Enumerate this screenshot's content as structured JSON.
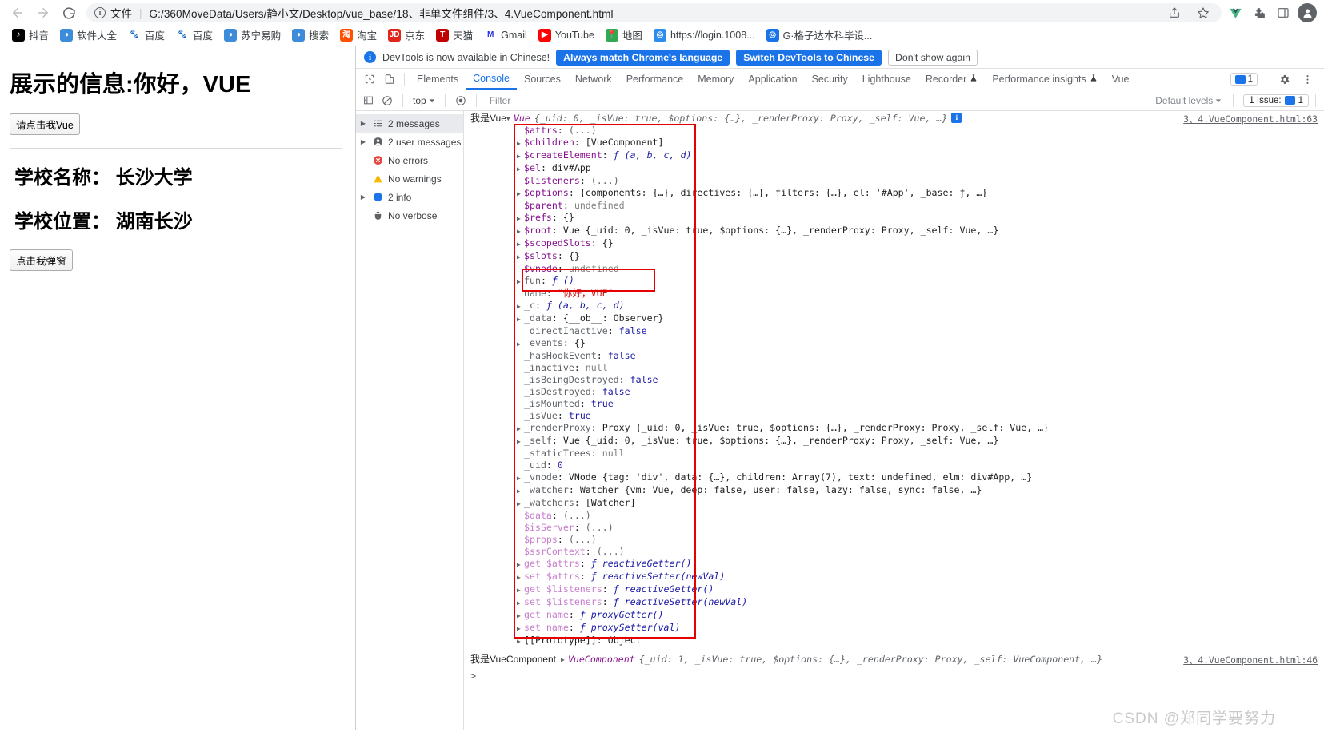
{
  "browser": {
    "nav": {
      "back": "←",
      "forward": "→",
      "reload": "↻"
    },
    "omnibox": {
      "scheme_label": "文件",
      "url": "G:/360MoveData/Users/静小文/Desktop/vue_base/18、非单文件组件/3、4.VueComponent.html",
      "info_icon": "info-icon",
      "share_icon": "share-icon",
      "star_icon": "bookmark-star-icon",
      "vue_ext_icon": "vue-extension-icon",
      "puzzle_icon": "extensions-puzzle-icon",
      "sidepanel_icon": "side-panel-icon",
      "profile_icon": "profile-avatar-icon"
    },
    "bookmarks": [
      {
        "label": "抖音",
        "icon": "douyin-icon",
        "color": "#000000",
        "glyph": "♪"
      },
      {
        "label": "软件大全",
        "icon": "globe-icon",
        "color": "#3c8cd9",
        "glyph": "◑"
      },
      {
        "label": "百度",
        "icon": "baidu-icon",
        "color": "#ffffff",
        "glyph": "🐾"
      },
      {
        "label": "百度",
        "icon": "baidu-icon",
        "color": "#ffffff",
        "glyph": "🐾"
      },
      {
        "label": "苏宁易购",
        "icon": "globe-icon",
        "color": "#3c8cd9",
        "glyph": "◑"
      },
      {
        "label": "搜索",
        "icon": "globe-icon",
        "color": "#3c8cd9",
        "glyph": "◑"
      },
      {
        "label": "淘宝",
        "icon": "taobao-icon",
        "color": "#ff5000",
        "glyph": "淘"
      },
      {
        "label": "京东",
        "icon": "jd-icon",
        "color": "#e1251b",
        "glyph": "JD"
      },
      {
        "label": "天猫",
        "icon": "tmall-icon",
        "color": "#c00000",
        "glyph": "T"
      },
      {
        "label": "Gmail",
        "icon": "gmail-icon",
        "color": "#ffffff",
        "glyph": "M"
      },
      {
        "label": "YouTube",
        "icon": "youtube-icon",
        "color": "#ff0000",
        "glyph": "▶"
      },
      {
        "label": "地图",
        "icon": "maps-icon",
        "color": "#34a853",
        "glyph": "📍"
      },
      {
        "label": "https://login.1008...",
        "icon": "globe-blue-icon",
        "color": "#2d8cf0",
        "glyph": "◎"
      },
      {
        "label": "G·格子达本科毕设...",
        "icon": "blue-swirl-icon",
        "color": "#1a73e8",
        "glyph": "◎"
      }
    ]
  },
  "page": {
    "heading": "展示的信息:你好，VUE",
    "button_vue": "请点击我Vue",
    "school_name": "学校名称： 长沙大学",
    "school_location": "学校位置： 湖南长沙",
    "button_alert": "点击我弹窗"
  },
  "devtools": {
    "banner": {
      "message": "DevTools is now available in Chinese!",
      "btn_always": "Always match Chrome's language",
      "btn_switch": "Switch DevTools to Chinese",
      "btn_dismiss": "Don't show again",
      "accent": "#1a73e8"
    },
    "tabs": [
      {
        "label": "Elements",
        "active": false,
        "warn": false
      },
      {
        "label": "Console",
        "active": true,
        "warn": false
      },
      {
        "label": "Sources",
        "active": false,
        "warn": false
      },
      {
        "label": "Network",
        "active": false,
        "warn": false
      },
      {
        "label": "Performance",
        "active": false,
        "warn": false
      },
      {
        "label": "Memory",
        "active": false,
        "warn": false
      },
      {
        "label": "Application",
        "active": false,
        "warn": false
      },
      {
        "label": "Security",
        "active": false,
        "warn": false
      },
      {
        "label": "Lighthouse",
        "active": false,
        "warn": false
      },
      {
        "label": "Recorder",
        "active": false,
        "warn": true
      },
      {
        "label": "Performance insights",
        "active": false,
        "warn": true
      },
      {
        "label": "Vue",
        "active": false,
        "warn": false
      }
    ],
    "tabs_right": {
      "issue_count": "1",
      "settings_icon": "gear-icon",
      "more_icon": "more-vertical-icon"
    },
    "filterbar": {
      "sidebar_toggle_icon": "sidebar-toggle-icon",
      "clear_icon": "clear-console-icon",
      "context": "top",
      "eye_icon": "live-expression-eye-icon",
      "filter_placeholder": "Filter",
      "filter_value": "",
      "levels": "Default levels",
      "issues_label": "1 Issue:",
      "issues_count": "1"
    },
    "sidebar": [
      {
        "label": "2 messages",
        "icon": "list-icon",
        "arrow": true,
        "selected": true
      },
      {
        "label": "2 user messages",
        "icon": "user-icon",
        "arrow": true,
        "selected": false
      },
      {
        "label": "No errors",
        "icon": "error-icon",
        "arrow": false,
        "selected": false
      },
      {
        "label": "No warnings",
        "icon": "warning-icon",
        "arrow": false,
        "selected": false
      },
      {
        "label": "2 info",
        "icon": "info-icon",
        "arrow": true,
        "selected": false
      },
      {
        "label": "No verbose",
        "icon": "bug-icon",
        "arrow": false,
        "selected": false
      }
    ],
    "console": {
      "msg1": {
        "prefix": "我是Vue",
        "summary_obj": "Vue",
        "summary_rest": "{_uid: 0, _isVue: true, $options: {…}, _renderProxy: Proxy, _self: Vue, …}",
        "source": "3、4.VueComponent.html:63",
        "info_badge": "i",
        "properties": [
          {
            "arrow": false,
            "key": "$attrs",
            "keycls": "t-key",
            "value": "(...)",
            "valcls": "t-dim"
          },
          {
            "arrow": true,
            "key": "$children",
            "keycls": "t-key",
            "value": "[VueComponent]",
            "valcls": "t-plain"
          },
          {
            "arrow": true,
            "key": "$createElement",
            "keycls": "t-key",
            "value": "ƒ (a, b, c, d)",
            "valcls": "t-fn"
          },
          {
            "arrow": true,
            "key": "$el",
            "keycls": "t-key",
            "value": "div#App",
            "valcls": "t-plain"
          },
          {
            "arrow": false,
            "key": "$listeners",
            "keycls": "t-key",
            "value": "(...)",
            "valcls": "t-dim"
          },
          {
            "arrow": true,
            "key": "$options",
            "keycls": "t-key",
            "value": "{components: {…}, directives: {…}, filters: {…}, el: '#App', _base: ƒ, …}",
            "valcls": "t-plain"
          },
          {
            "arrow": false,
            "key": "$parent",
            "keycls": "t-key",
            "value": "undefined",
            "valcls": "t-null"
          },
          {
            "arrow": true,
            "key": "$refs",
            "keycls": "t-key",
            "value": "{}",
            "valcls": "t-plain"
          },
          {
            "arrow": true,
            "key": "$root",
            "keycls": "t-key",
            "value": "Vue {_uid: 0, _isVue: true, $options: {…}, _renderProxy: Proxy, _self: Vue, …}",
            "valcls": "t-plain"
          },
          {
            "arrow": true,
            "key": "$scopedSlots",
            "keycls": "t-key",
            "value": "{}",
            "valcls": "t-plain"
          },
          {
            "arrow": true,
            "key": "$slots",
            "keycls": "t-key",
            "value": "{}",
            "valcls": "t-plain"
          },
          {
            "arrow": false,
            "key": "$vnode",
            "keycls": "t-key",
            "value": "undefined",
            "valcls": "t-null"
          },
          {
            "arrow": true,
            "key": "fun",
            "keycls": "t-keyd",
            "value": "ƒ ()",
            "valcls": "t-fn"
          },
          {
            "arrow": false,
            "key": "name",
            "keycls": "t-keyd",
            "value": "\"你好，VUE\"",
            "valcls": "t-str"
          },
          {
            "arrow": true,
            "key": "_c",
            "keycls": "t-keyd",
            "value": "ƒ (a, b, c, d)",
            "valcls": "t-fn"
          },
          {
            "arrow": true,
            "key": "_data",
            "keycls": "t-keyd",
            "value": "{__ob__: Observer}",
            "valcls": "t-plain"
          },
          {
            "arrow": false,
            "key": "_directInactive",
            "keycls": "t-keyd",
            "value": "false",
            "valcls": "t-bool"
          },
          {
            "arrow": true,
            "key": "_events",
            "keycls": "t-keyd",
            "value": "{}",
            "valcls": "t-plain"
          },
          {
            "arrow": false,
            "key": "_hasHookEvent",
            "keycls": "t-keyd",
            "value": "false",
            "valcls": "t-bool"
          },
          {
            "arrow": false,
            "key": "_inactive",
            "keycls": "t-keyd",
            "value": "null",
            "valcls": "t-null"
          },
          {
            "arrow": false,
            "key": "_isBeingDestroyed",
            "keycls": "t-keyd",
            "value": "false",
            "valcls": "t-bool"
          },
          {
            "arrow": false,
            "key": "_isDestroyed",
            "keycls": "t-keyd",
            "value": "false",
            "valcls": "t-bool"
          },
          {
            "arrow": false,
            "key": "_isMounted",
            "keycls": "t-keyd",
            "value": "true",
            "valcls": "t-bool"
          },
          {
            "arrow": false,
            "key": "_isVue",
            "keycls": "t-keyd",
            "value": "true",
            "valcls": "t-bool"
          },
          {
            "arrow": true,
            "key": "_renderProxy",
            "keycls": "t-keyd",
            "value": "Proxy {_uid: 0, _isVue: true, $options: {…}, _renderProxy: Proxy, _self: Vue, …}",
            "valcls": "t-plain"
          },
          {
            "arrow": true,
            "key": "_self",
            "keycls": "t-keyd",
            "value": "Vue {_uid: 0, _isVue: true, $options: {…}, _renderProxy: Proxy, _self: Vue, …}",
            "valcls": "t-plain"
          },
          {
            "arrow": false,
            "key": "_staticTrees",
            "keycls": "t-keyd",
            "value": "null",
            "valcls": "t-null"
          },
          {
            "arrow": false,
            "key": "_uid",
            "keycls": "t-keyd",
            "value": "0",
            "valcls": "t-num"
          },
          {
            "arrow": true,
            "key": "_vnode",
            "keycls": "t-keyd",
            "value": "VNode {tag: 'div', data: {…}, children: Array(7), text: undefined, elm: div#App, …}",
            "valcls": "t-plain"
          },
          {
            "arrow": true,
            "key": "_watcher",
            "keycls": "t-keyd",
            "value": "Watcher {vm: Vue, deep: false, user: false, lazy: false, sync: false, …}",
            "valcls": "t-plain"
          },
          {
            "arrow": true,
            "key": "_watchers",
            "keycls": "t-keyd",
            "value": "[Watcher]",
            "valcls": "t-plain"
          },
          {
            "arrow": false,
            "key": "$data",
            "keycls": "t-accessor",
            "value": "(...)",
            "valcls": "t-dim"
          },
          {
            "arrow": false,
            "key": "$isServer",
            "keycls": "t-accessor",
            "value": "(...)",
            "valcls": "t-dim"
          },
          {
            "arrow": false,
            "key": "$props",
            "keycls": "t-accessor",
            "value": "(...)",
            "valcls": "t-dim"
          },
          {
            "arrow": false,
            "key": "$ssrContext",
            "keycls": "t-accessor",
            "value": "(...)",
            "valcls": "t-dim"
          },
          {
            "arrow": true,
            "key": "get $attrs",
            "keycls": "t-accessor",
            "value": "ƒ reactiveGetter()",
            "valcls": "t-fn"
          },
          {
            "arrow": true,
            "key": "set $attrs",
            "keycls": "t-accessor",
            "value": "ƒ reactiveSetter(newVal)",
            "valcls": "t-fn"
          },
          {
            "arrow": true,
            "key": "get $listeners",
            "keycls": "t-accessor",
            "value": "ƒ reactiveGetter()",
            "valcls": "t-fn"
          },
          {
            "arrow": true,
            "key": "set $listeners",
            "keycls": "t-accessor",
            "value": "ƒ reactiveSetter(newVal)",
            "valcls": "t-fn"
          },
          {
            "arrow": true,
            "key": "get name",
            "keycls": "t-accessor",
            "value": "ƒ proxyGetter()",
            "valcls": "t-fn"
          },
          {
            "arrow": true,
            "key": "set name",
            "keycls": "t-accessor",
            "value": "ƒ proxySetter(val)",
            "valcls": "t-fn"
          },
          {
            "arrow": true,
            "key": "[[Prototype]]",
            "keycls": "t-proto",
            "value": "Object",
            "valcls": "t-plain"
          }
        ]
      },
      "msg2": {
        "prefix": "我是VueComponent",
        "summary_obj": "VueComponent",
        "summary_rest": "{_uid: 1, _isVue: true, $options: {…}, _renderProxy: Proxy, _self: VueComponent, …}",
        "source": "3、4.VueComponent.html:46"
      },
      "prompt": ">"
    }
  },
  "watermark": "CSDN @郑同学要努力"
}
